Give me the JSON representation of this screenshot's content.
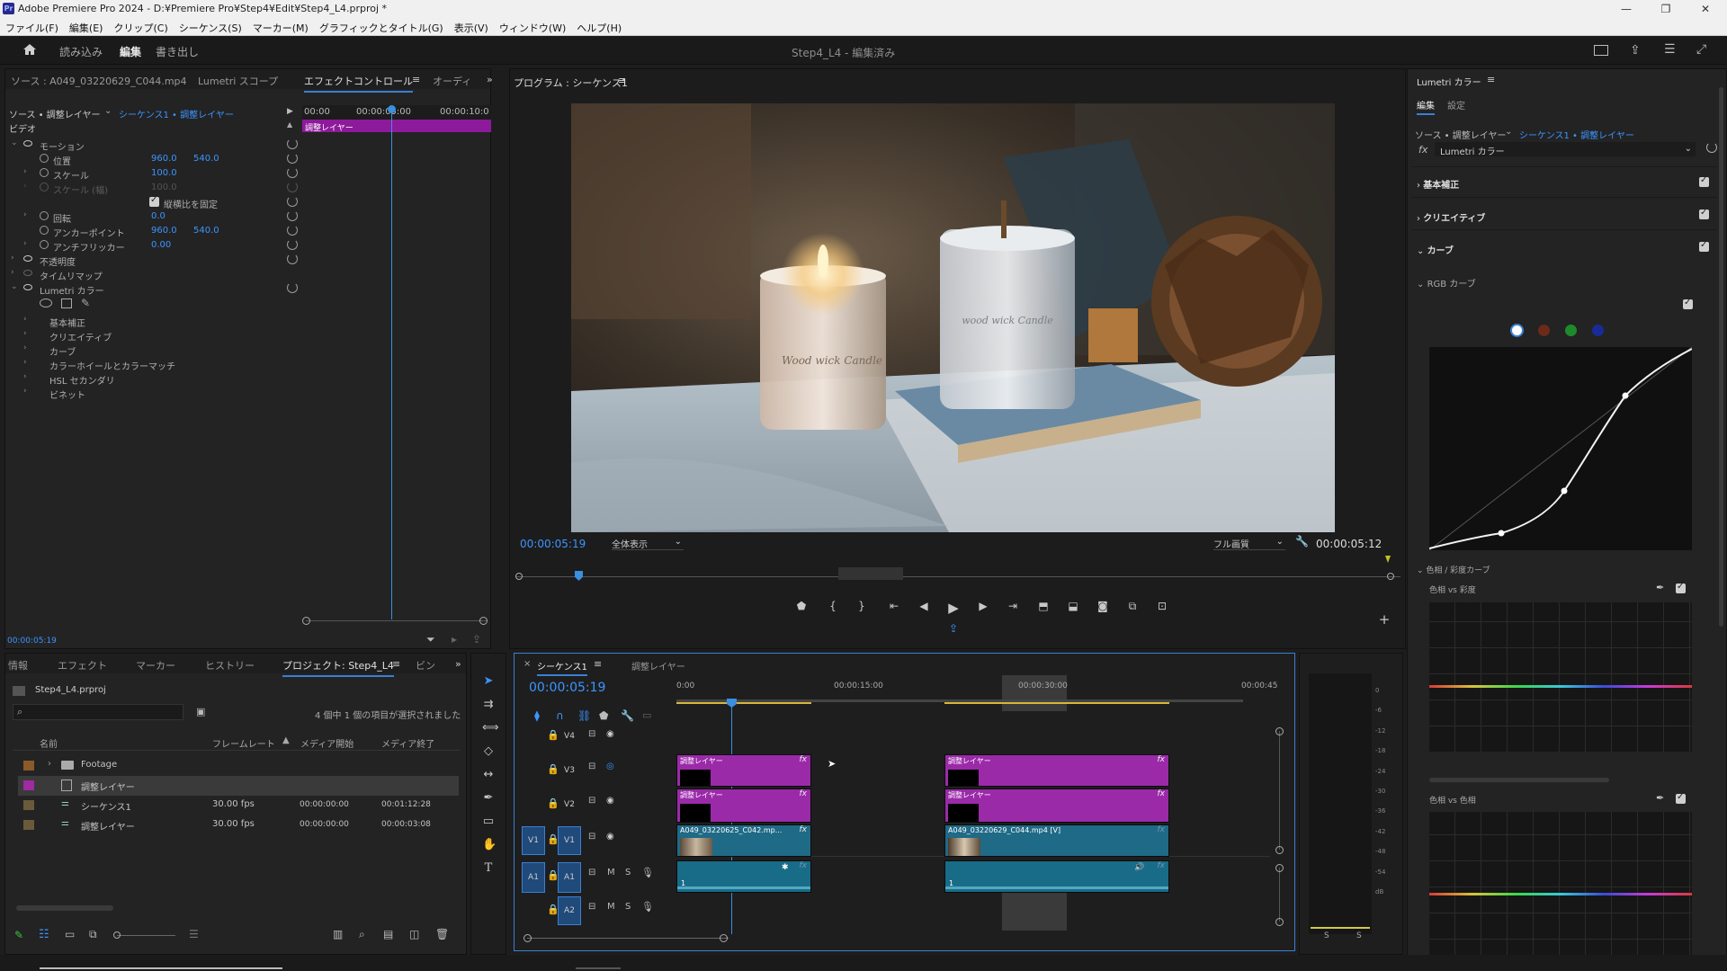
{
  "window": {
    "title": "Adobe Premiere Pro 2024 - D:¥Premiere Pro¥Step4¥Edit¥Step4_L4.prproj *"
  },
  "menu": [
    "ファイル(F)",
    "編集(E)",
    "クリップ(C)",
    "シーケンス(S)",
    "マーカー(M)",
    "グラフィックとタイトル(G)",
    "表示(V)",
    "ウィンドウ(W)",
    "ヘルプ(H)"
  ],
  "header": {
    "tabs": [
      "読み込み",
      "編集",
      "書き出し"
    ],
    "active_tab": "編集",
    "project_title": "Step4_L4 - 編集済み"
  },
  "source_panel": {
    "tabs": [
      "ソース : A049_03220629_C044.mp4",
      "Lumetri スコープ",
      "エフェクトコントロール",
      "オーディ"
    ],
    "sequence_source": "ソース • 調整レイヤー",
    "sequence_target": "シーケンス1 • 調整レイヤー",
    "video_label": "ビデオ",
    "tc_start": "00:00",
    "tc_mid": "00:00:05:00",
    "tc_end": "00:00:10:0",
    "clip_bar_label": "調整レイヤー",
    "current_time": "00:00:05:19",
    "rows": {
      "motion": "モーション",
      "position": "位置",
      "position_x": "960.0",
      "position_y": "540.0",
      "scale": "スケール",
      "scale_value": "100.0",
      "scale_width": "スケール (幅)",
      "scale_width_value": "100.0",
      "uniform_scale": "縦横比を固定",
      "rotation": "回転",
      "rotation_value": "0.0",
      "anchor": "アンカーポイント",
      "anchor_x": "960.0",
      "anchor_y": "540.0",
      "antiflicker": "アンチフリッカー",
      "antiflicker_value": "0.00",
      "opacity": "不透明度",
      "time_remap": "タイムリマップ",
      "lumetri": "Lumetri カラー",
      "basic": "基本補正",
      "creative": "クリエイティブ",
      "curves": "カーブ",
      "color_wheels": "カラーホイールとカラーマッチ",
      "hsl": "HSL セカンダリ",
      "vignette": "ビネット"
    }
  },
  "program_monitor": {
    "title": "プログラム : シーケンス1",
    "current_time": "00:00:05:19",
    "zoom": "全体表示",
    "quality": "フル画質",
    "duration": "00:00:05:12",
    "frame_scene": {
      "candle1_text": "Wood wick Candle",
      "candle2_text": "wood wick Candle"
    }
  },
  "lumetri": {
    "title": "Lumetri カラー",
    "tabs": [
      "編集",
      "設定"
    ],
    "active_tab": "編集",
    "source": "ソース • 調整レイヤー",
    "target": "シーケンス1 • 調整レイヤー",
    "effect": "Lumetri カラー",
    "sections": [
      "基本補正",
      "クリエイティブ",
      "カーブ"
    ],
    "rgb_curve": "RGB カーブ",
    "hue_sat_curves": "色相 / 彩度カーブ",
    "hue_vs_sat": "色相 vs 彩度",
    "hue_vs_hue": "色相 vs 色相",
    "curve_channel_colors": [
      "#ffffff",
      "#6b2a1a",
      "#1e8a2c",
      "#1a2a9a"
    ]
  },
  "project_panel": {
    "tabs": [
      "情報",
      "エフェクト",
      "マーカー",
      "ヒストリー",
      "プロジェクト: Step4_L4",
      "ビン"
    ],
    "file": "Step4_L4.prproj",
    "selection_info": "4 個中 1 個の項目が選択されました",
    "columns": [
      "名前",
      "フレームレート",
      "メディア開始",
      "メディア終了"
    ],
    "items": [
      {
        "name": "Footage",
        "type": "folder",
        "fps": "",
        "start": "",
        "end": "",
        "color": "#8a5a2a"
      },
      {
        "name": "調整レイヤー",
        "type": "adjust",
        "fps": "",
        "start": "",
        "end": "",
        "color": "#a02aa0"
      },
      {
        "name": "シーケンス1",
        "type": "sequence",
        "fps": "30.00 fps",
        "start": "00:00:00:00",
        "end": "00:01:12:28",
        "color": "#6b5a3a"
      },
      {
        "name": "調整レイヤー",
        "type": "sequence",
        "fps": "30.00 fps",
        "start": "00:00:00:00",
        "end": "00:00:03:08",
        "color": "#6b5a3a"
      }
    ]
  },
  "timeline": {
    "tabs": [
      "シーケンス1",
      "調整レイヤー"
    ],
    "current_time": "00:00:05:19",
    "ruler": [
      "0:00",
      "00:00:15:00",
      "00:00:30:00",
      "00:00:45"
    ],
    "tracks": [
      "V4",
      "V3",
      "V2",
      "V1",
      "A1",
      "A2"
    ],
    "source_tracks": [
      "V1",
      "A1"
    ],
    "clips": {
      "adj1": "調整レイヤー",
      "adj2": "調整レイヤー",
      "adj3": "調整レイヤー",
      "adj4": "調整レイヤー",
      "v1a": "A049_03220625_C042.mp...",
      "v1b": "A049_03220629_C044.mp4 [V]",
      "a1a": "1",
      "a1b": "1"
    },
    "audio_buttons": {
      "mute": "M",
      "solo": "S"
    }
  },
  "meter": {
    "scale": [
      "0",
      "-6",
      "-12",
      "-18",
      "-24",
      "-30",
      "-36",
      "-42",
      "-48",
      "-54",
      "dB"
    ],
    "solo_left": "S",
    "solo_right": "S"
  }
}
